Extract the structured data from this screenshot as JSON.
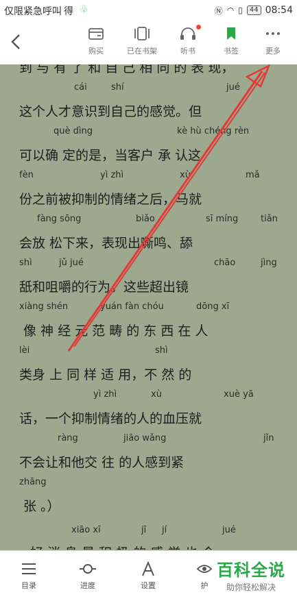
{
  "status_bar": {
    "carrier_text": "仅限紧急呼叫",
    "carrier_extra": "得",
    "time": "08:54",
    "battery": "44"
  },
  "toolbar": {
    "buy": "购买",
    "on_shelf": "已在书架",
    "listen": "听书",
    "bookmark": "书签",
    "more": "更多"
  },
  "content_lines": [
    {
      "text": "到 与 有 了 和 自 己 相 同 的 表 现，"
    },
    {
      "text": "这个人才意识到自己的感觉。但"
    },
    {
      "text": "可以确 定的是，当客户 承 认这"
    },
    {
      "text": "份之前被抑制的情绪之后，马就"
    },
    {
      "text": "会放 松下来，表现出嘶鸣、舔"
    },
    {
      "text": "舐和咀嚼的行为。这些超出镜"
    },
    {
      "text": "像 神 经 元 范 畴 的 东 西 在 人"
    },
    {
      "text": "类身 上 同 样 适 用，不 然 的"
    },
    {
      "text": "话，一个抑制情绪的人的血压就"
    },
    {
      "text": "不会让和他交 往 的人感到紧"
    },
    {
      "text": "张 。）"
    },
    {
      "text": "好 消 息 是 积 极 的 感 觉 也 会"
    }
  ],
  "pinyin_lines": [
    {
      "words": [
        "cái",
        "shí",
        "jué"
      ]
    },
    {
      "words": [
        "què dìng",
        "kè hù chéng rèn"
      ]
    },
    {
      "words": [
        "fèn",
        "yì zhì",
        "xù",
        "mǎ"
      ]
    },
    {
      "words": [
        "fàng sōng",
        "biǎo",
        "sī míng",
        "tiǎn"
      ]
    },
    {
      "words": [
        "shì",
        "jǔ jué",
        "chāo",
        "jìng"
      ]
    },
    {
      "words": [
        "xiàng shén",
        "yuán fàn chóu",
        "dōng xī"
      ]
    },
    {
      "words": [
        "lèi",
        "shì"
      ]
    },
    {
      "words": [
        "yì zhì",
        "xù",
        "xuè yā"
      ]
    },
    {
      "words": [
        "ràng",
        "jiāo wǎng",
        "jǐn"
      ]
    },
    {
      "words": [
        "zhāng"
      ]
    },
    {
      "words": [
        "xiāo xī",
        "jī",
        "jí",
        "jué"
      ]
    }
  ],
  "bottom_bar": {
    "catalog": "目录",
    "progress": "进度",
    "settings": "设置",
    "eye": "护"
  },
  "watermark": {
    "title": "百科全说",
    "subtitle": "助你轻松解决"
  },
  "colors": {
    "page_bg": "#9ca98f",
    "arrow": "#e23a36",
    "accent_green": "#2aa84a"
  }
}
